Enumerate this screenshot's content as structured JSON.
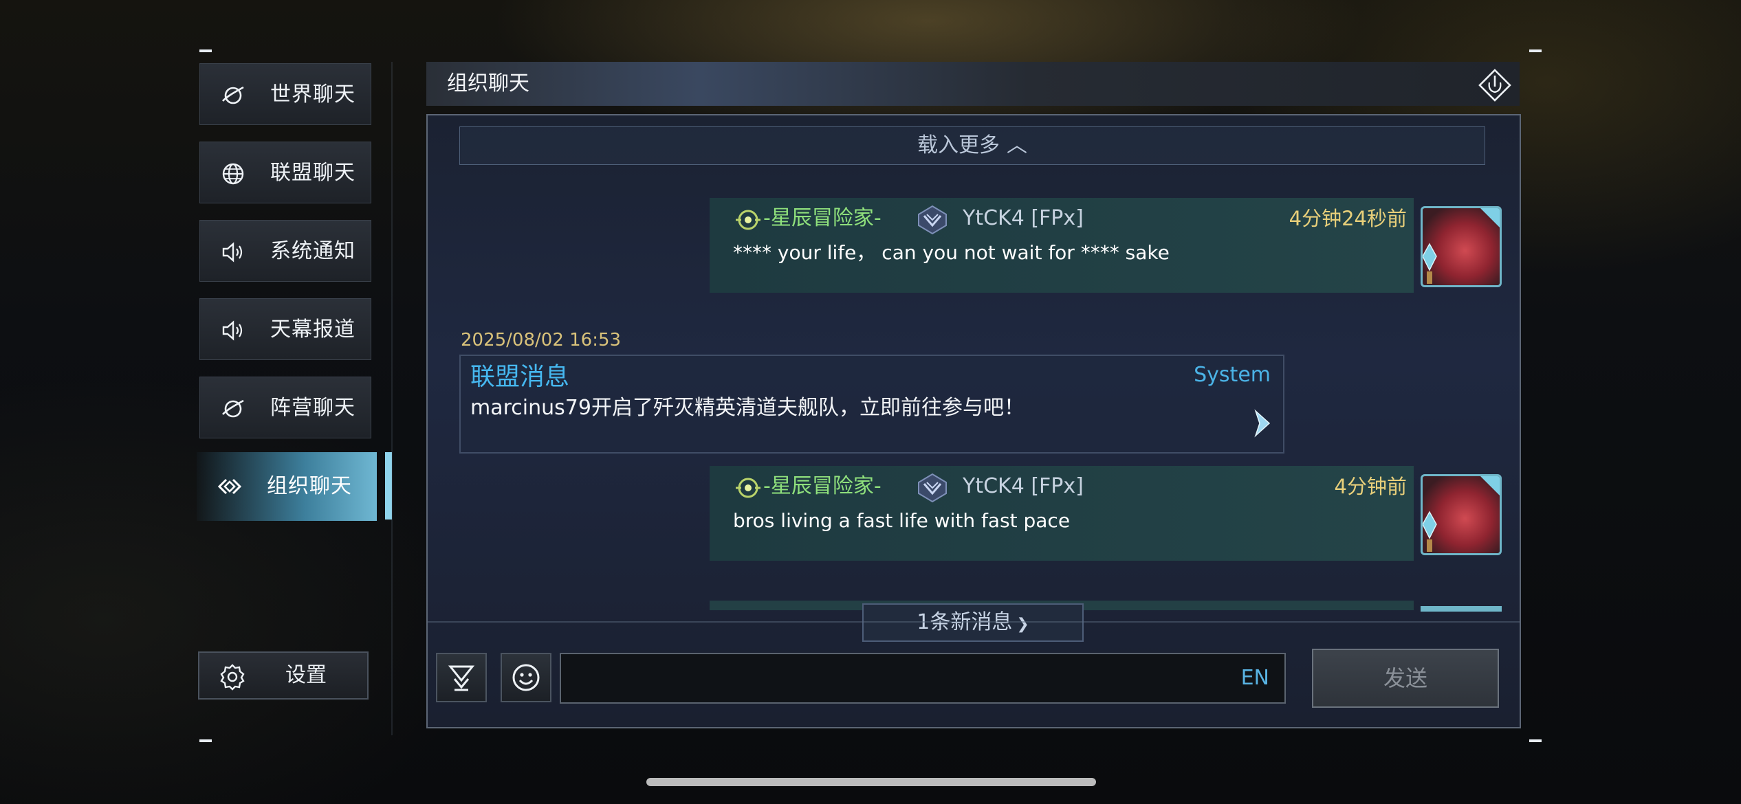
{
  "sidebar": {
    "items": [
      {
        "label": "世界聊天",
        "icon": "planet-icon"
      },
      {
        "label": "联盟聊天",
        "icon": "globe-icon"
      },
      {
        "label": "系统通知",
        "icon": "speaker-icon"
      },
      {
        "label": "天幕报道",
        "icon": "speaker-icon"
      },
      {
        "label": "阵营聊天",
        "icon": "planet-icon"
      },
      {
        "label": "组织聊天",
        "icon": "diamond-link-icon"
      }
    ],
    "active_index": 5,
    "settings_label": "设置"
  },
  "header": {
    "title": "组织聊天"
  },
  "chat": {
    "load_more": "载入更多",
    "messages": [
      {
        "title": "-星辰冒险家-",
        "name": "YtCK4 [FPx]",
        "time": "4分钟24秒前",
        "text": "**** your life， can you not wait for **** sake"
      },
      {
        "title": "-星辰冒险家-",
        "name": "YtCK4 [FPx]",
        "time": "4分钟前",
        "text": "bros living a fast life with fast pace"
      }
    ],
    "system": {
      "date": "2025/08/02 16:53",
      "heading": "联盟消息",
      "tag": "System",
      "body": "marcinus79开启了歼灭精英清道夫舰队，立即前往参与吧！"
    },
    "new_messages": "1条新消息"
  },
  "input": {
    "value": "",
    "lang": "EN",
    "send_label": "发送"
  },
  "colors": {
    "accent": "#6fb7d2",
    "title_green": "#8fe07c",
    "time_gold": "#e8cf7a",
    "system_blue": "#46b8f0"
  }
}
